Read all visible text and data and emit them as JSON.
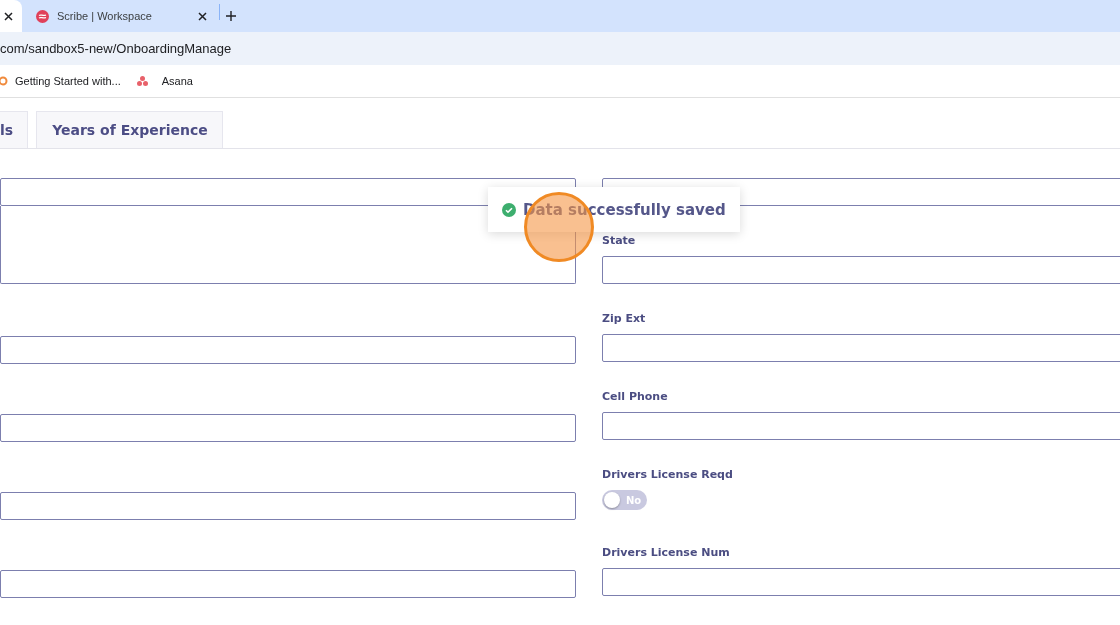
{
  "browser": {
    "tabs": [
      {
        "selected": true
      },
      {
        "title": "Scribe | Workspace",
        "selected": false
      }
    ],
    "address": "com/sandbox5-new/OnboardingManage",
    "bookmarks": [
      {
        "label": "Getting Started with...",
        "kind": "ring"
      },
      {
        "label": "Asana",
        "kind": "dots"
      }
    ]
  },
  "page_tabs": [
    {
      "label": "ls",
      "selected": false
    },
    {
      "label": "Years of Experience",
      "selected": false
    }
  ],
  "left_fields": [
    {
      "kind": "input"
    },
    {
      "kind": "textarea"
    },
    {
      "kind": "input"
    },
    {
      "kind": "input"
    },
    {
      "kind": "input"
    },
    {
      "kind": "input"
    }
  ],
  "right_fields": [
    {
      "kind": "input"
    },
    {
      "kind": "input",
      "label": "State"
    },
    {
      "kind": "input",
      "label": "Zip Ext"
    },
    {
      "kind": "input",
      "label": "Cell Phone"
    },
    {
      "kind": "toggle",
      "label": "Drivers License Reqd",
      "on": false,
      "value": "No"
    },
    {
      "kind": "input",
      "label": "Drivers License Num"
    }
  ],
  "toast": {
    "message": "Data successfully saved"
  }
}
